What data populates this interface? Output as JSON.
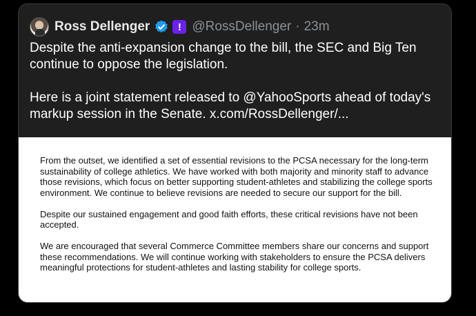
{
  "tweet": {
    "display_name": "Ross Dellenger",
    "handle": "@RossDellenger",
    "separator": "·",
    "time": "23m",
    "badge_label": "!",
    "text_p1": "Despite the anti-expansion change to the bill, the SEC and Big Ten continue to oppose the legislation.",
    "text_p2_prefix": "Here is a joint statement released to @YahooSports ahead of today's markup session in the Senate. ",
    "link": "x.com/RossDellenger/..."
  },
  "statement": {
    "paragraphs": [
      "From the outset, we identified a set of essential revisions to the PCSA necessary for the long-term sustainability of college athletics. We have worked with both majority and minority staff to advance those revisions, which focus on better supporting student-athletes and stabilizing the college sports environment. We continue to believe revisions are needed to secure our support for the bill.",
      "Despite our sustained engagement and good faith efforts, these critical revisions have not been accepted.",
      "We are encouraged that several Commerce Committee members share our concerns and support these recommendations. We will continue working with stakeholders to ensure the PCSA delivers meaningful protections for student-athletes and lasting stability for college sports."
    ]
  },
  "colors": {
    "card_background": "#1f1f1f",
    "verified_blue": "#1d9bf0",
    "yahoo_purple": "#6b21e8",
    "secondary_text": "#8b9096"
  },
  "icons": {
    "verified": "verified-badge-icon",
    "affiliate": "yahoo-sports-badge-icon"
  }
}
